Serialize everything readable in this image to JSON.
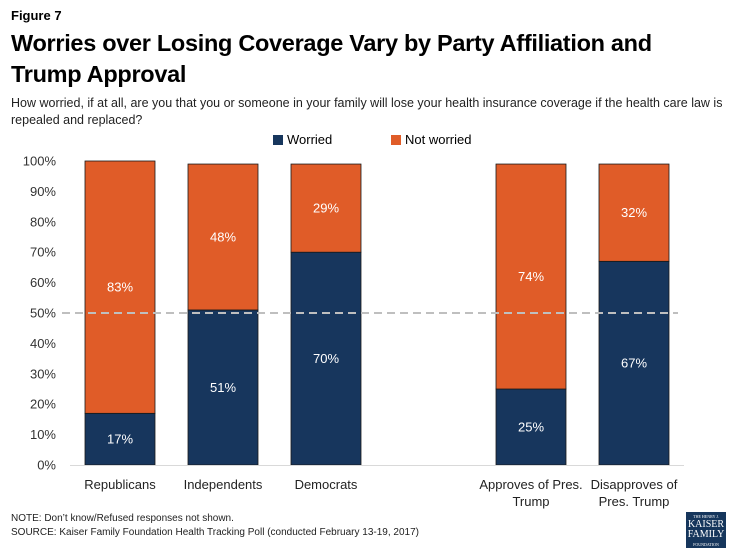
{
  "figure_label": "Figure 7",
  "title": "Worries over Losing Coverage Vary by Party Affiliation and Trump Approval",
  "subtitle": "How worried, if at all, are you that you or someone in your family will lose your health insurance coverage if the health care law is repealed and replaced?",
  "legend": [
    {
      "name": "Worried",
      "color": "#17365d"
    },
    {
      "name": "Not worried",
      "color": "#e05c28"
    }
  ],
  "chart_data": {
    "type": "bar",
    "stacked": true,
    "title": "Worries over Losing Coverage Vary by Party Affiliation and Trump Approval",
    "categories": [
      "Republicans",
      "Independents",
      "Democrats",
      "Approves of Pres. Trump",
      "Disapproves of Pres. Trump"
    ],
    "category_lines": [
      [
        "Republicans"
      ],
      [
        "Independents"
      ],
      [
        "Democrats"
      ],
      [
        "Approves of Pres.",
        "Trump"
      ],
      [
        "Disapproves of",
        "Pres. Trump"
      ]
    ],
    "series": [
      {
        "name": "Worried",
        "color": "#17365d",
        "values": [
          17,
          51,
          70,
          25,
          67
        ],
        "labels": [
          "17%",
          "51%",
          "70%",
          "25%",
          "67%"
        ]
      },
      {
        "name": "Not worried",
        "color": "#e05c28",
        "values": [
          83,
          48,
          29,
          74,
          32
        ],
        "labels": [
          "83%",
          "48%",
          "29%",
          "74%",
          "32%"
        ]
      }
    ],
    "yticks": [
      "0%",
      "10%",
      "20%",
      "30%",
      "40%",
      "50%",
      "60%",
      "70%",
      "80%",
      "90%",
      "100%"
    ],
    "ylim": [
      0,
      100
    ],
    "reference_line": {
      "value": 50,
      "style": "dashed",
      "color": "#bfbfbf"
    },
    "xlabel": "",
    "ylabel": "",
    "grid": false,
    "legend_position": "top-center"
  },
  "footer": {
    "note": "NOTE: Don’t know/Refused responses not shown.",
    "source": "SOURCE: Kaiser Family Foundation Health Tracking Poll (conducted February 13-19, 2017)"
  },
  "logo": {
    "line1": "THE HENRY J.",
    "line2": "KAISER",
    "line3": "FAMILY",
    "line4": "FOUNDATION"
  }
}
